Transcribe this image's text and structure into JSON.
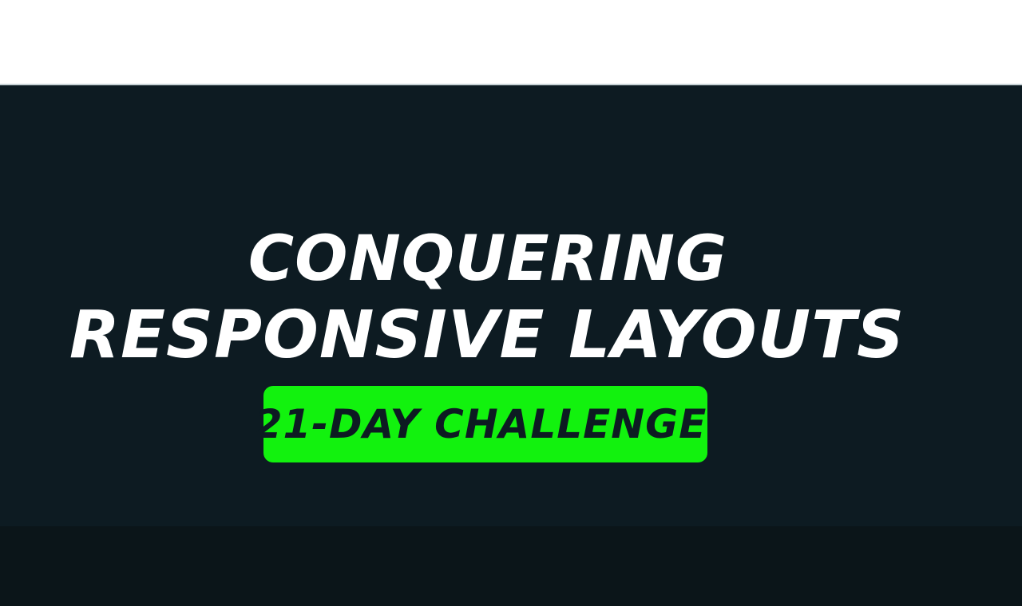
{
  "hero": {
    "title_line1": "Conquering",
    "title_line2": "Responsive Layouts",
    "badge_label": "21-Day Challenge"
  },
  "colors": {
    "hero_background": "#0d1b22",
    "badge_background": "#12f20e",
    "title_text": "#ffffff",
    "badge_text": "#0d1b22"
  }
}
